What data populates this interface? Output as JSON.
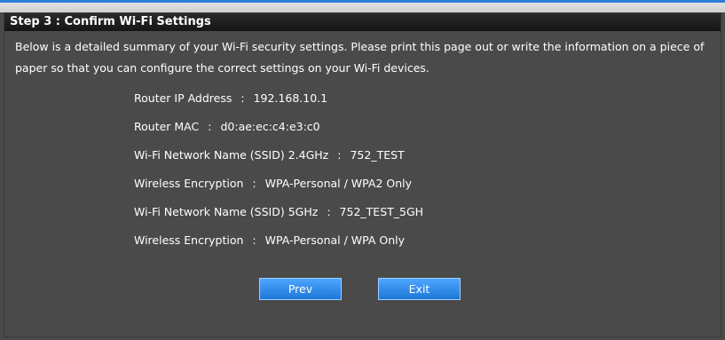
{
  "header": {
    "title": "Step 3 : Confirm Wi-Fi Settings"
  },
  "intro": {
    "text": "Below is a detailed summary of your Wi-Fi security settings. Please print this page out or write the information on a piece of paper so that you can configure the correct settings on your Wi-Fi devices."
  },
  "settings": {
    "separator": ":",
    "rows": [
      {
        "label": "Router IP Address",
        "value": "192.168.10.1"
      },
      {
        "label": "Router MAC",
        "value": "d0:ae:ec:c4:e3:c0"
      },
      {
        "label": "Wi-Fi Network Name (SSID) 2.4GHz",
        "value": "752_TEST"
      },
      {
        "label": "Wireless Encryption",
        "value": "WPA-Personal / WPA2 Only"
      },
      {
        "label": "Wi-Fi Network Name (SSID) 5GHz",
        "value": "752_TEST_5GH"
      },
      {
        "label": "Wireless Encryption",
        "value": "WPA-Personal / WPA Only"
      }
    ]
  },
  "buttons": {
    "prev_label": "Prev",
    "exit_label": "Exit"
  },
  "colors": {
    "header_bg": "#161616",
    "panel_bg": "#4a4a4a",
    "button_blue": "#1e76d8",
    "accent": "#2a7fd6"
  }
}
